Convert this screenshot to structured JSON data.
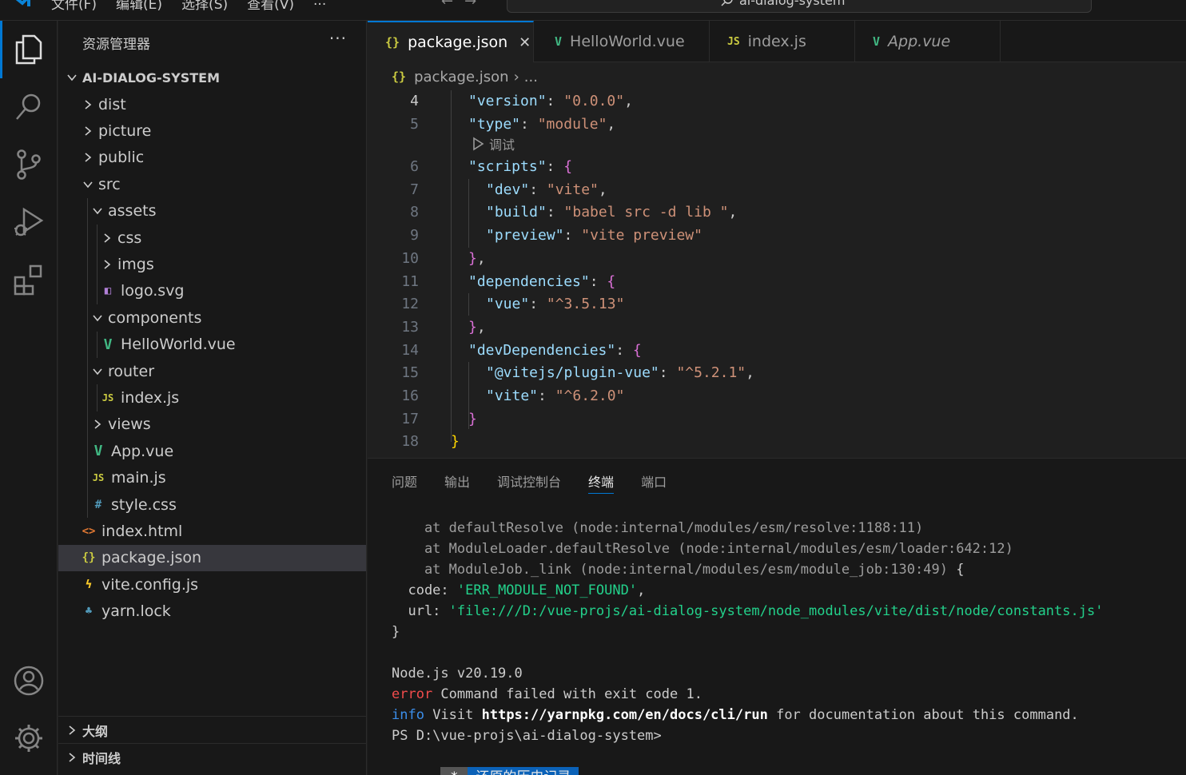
{
  "titlebar": {
    "menu": [
      "文件(F)",
      "编辑(E)",
      "选择(S)",
      "查看(V)",
      "..."
    ],
    "search_text": "ai-dialog-system"
  },
  "sidebar": {
    "title": "资源管理器",
    "root": "AI-DIALOG-SYSTEM",
    "tree": [
      {
        "label": "dist",
        "type": "folder",
        "open": false,
        "depth": 0
      },
      {
        "label": "picture",
        "type": "folder",
        "open": false,
        "depth": 0
      },
      {
        "label": "public",
        "type": "folder",
        "open": false,
        "depth": 0
      },
      {
        "label": "src",
        "type": "folder",
        "open": true,
        "depth": 0
      },
      {
        "label": "assets",
        "type": "folder",
        "open": true,
        "depth": 1
      },
      {
        "label": "css",
        "type": "folder",
        "open": false,
        "depth": 2
      },
      {
        "label": "imgs",
        "type": "folder",
        "open": false,
        "depth": 2
      },
      {
        "label": "logo.svg",
        "type": "svg",
        "depth": 2
      },
      {
        "label": "components",
        "type": "folder",
        "open": true,
        "depth": 1
      },
      {
        "label": "HelloWorld.vue",
        "type": "vue",
        "depth": 2
      },
      {
        "label": "router",
        "type": "folder",
        "open": true,
        "depth": 1
      },
      {
        "label": "index.js",
        "type": "js",
        "depth": 2
      },
      {
        "label": "views",
        "type": "folder",
        "open": false,
        "depth": 1
      },
      {
        "label": "App.vue",
        "type": "vue",
        "depth": 1
      },
      {
        "label": "main.js",
        "type": "js",
        "depth": 1
      },
      {
        "label": "style.css",
        "type": "css",
        "depth": 1
      },
      {
        "label": "index.html",
        "type": "html",
        "depth": 0
      },
      {
        "label": "package.json",
        "type": "json",
        "depth": 0,
        "selected": true
      },
      {
        "label": "vite.config.js",
        "type": "vite",
        "depth": 0
      },
      {
        "label": "yarn.lock",
        "type": "yarn",
        "depth": 0
      }
    ],
    "outline": "大纲",
    "timeline": "时间线"
  },
  "tabs": [
    {
      "label": "package.json",
      "icon": "{}",
      "active": true
    },
    {
      "label": "HelloWorld.vue",
      "icon": "V"
    },
    {
      "label": "index.js",
      "icon": "JS"
    },
    {
      "label": "App.vue",
      "icon": "V",
      "italic": true
    }
  ],
  "breadcrumb": {
    "file": "package.json",
    "rest": "..."
  },
  "codelens": "调试",
  "code": {
    "line_numbers": [
      "4",
      "5",
      "6",
      "7",
      "8",
      "9",
      "10",
      "11",
      "12",
      "13",
      "14",
      "15",
      "16",
      "17",
      "18"
    ],
    "lines": [
      "\"version\": \"0.0.0\",",
      "\"type\": \"module\",",
      "\"scripts\": {",
      "\"dev\": \"vite\",",
      "\"build\": \"babel src -d lib \",",
      "\"preview\": \"vite preview\"",
      "},",
      "\"dependencies\": {",
      "\"vue\": \"^3.5.13\"",
      "},",
      "\"devDependencies\": {",
      "\"@vitejs/plugin-vue\": \"^5.2.1\",",
      "\"vite\": \"^6.2.0\"",
      "}",
      "}"
    ]
  },
  "panel": {
    "tabs": [
      "问题",
      "输出",
      "调试控制台",
      "终端",
      "端口"
    ],
    "active_tab": "终端",
    "terminal": {
      "l1": "    at defaultResolve (node:internal/modules/esm/resolve:1188:11)",
      "l2": "    at ModuleLoader.defaultResolve (node:internal/modules/esm/loader:642:12)",
      "l3a": "    at ModuleJob._link (node:internal/modules/esm/module_job:130:49)",
      "l3b": " {",
      "code_key": "  code: ",
      "code_val": "'ERR_MODULE_NOT_FOUND'",
      "code_end": ",",
      "url_key": "  url: ",
      "url_val": "'file:///D:/vue-projs/ai-dialog-system/node_modules/vite/dist/node/constants.js'",
      "close": "}",
      "node": "Node.js v20.19.0",
      "error_word": "error",
      "error_rest": " Command failed with exit code 1.",
      "info_word": "info",
      "info_mid": " Visit ",
      "info_url": "https://yarnpkg.com/en/docs/cli/run",
      "info_rest": " for documentation about this command.",
      "prompt": "PS D:\\vue-projs\\ai-dialog-system>",
      "restore_star": "*",
      "restore_label": "还原的历史记录"
    }
  },
  "colors": {
    "accent": "#0078d4",
    "vue": "#41b883",
    "js": "#cbcb41",
    "json": "#cbcb41"
  }
}
